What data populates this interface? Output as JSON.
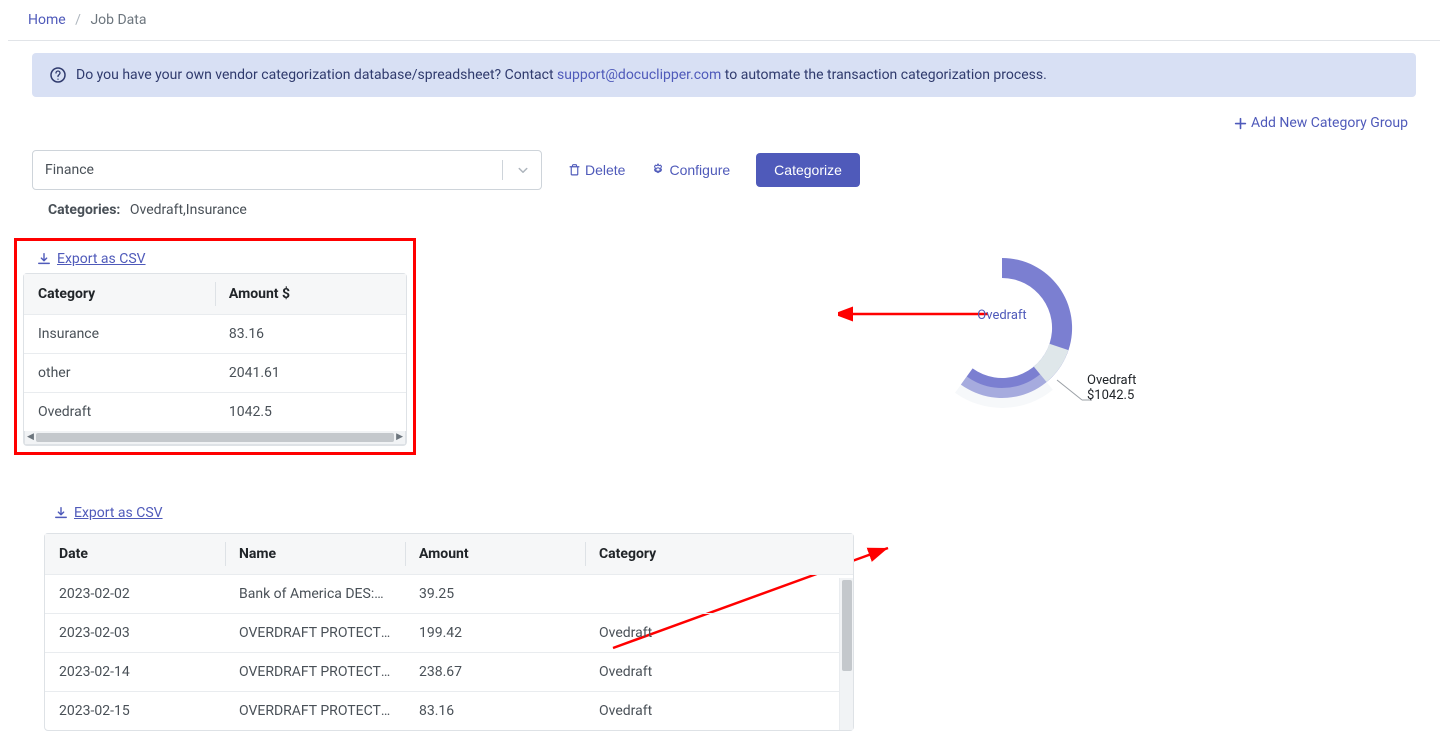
{
  "breadcrumb": {
    "home": "Home",
    "current": "Job Data"
  },
  "alert": {
    "pre": "Do you have your own vendor categorization database/spreadsheet? Contact ",
    "email": "support@docuclipper.com",
    "post": " to automate the transaction categorization process."
  },
  "toolbar": {
    "add_group": "Add New Category Group",
    "selected_group": "Finance",
    "delete": "Delete",
    "configure": "Configure",
    "categorize": "Categorize"
  },
  "categories": {
    "label": "Categories:",
    "list": "Ovedraft,Insurance"
  },
  "export_label": "Export as CSV",
  "summary_table": {
    "headers": {
      "category": "Category",
      "amount": "Amount $"
    },
    "rows": [
      {
        "category": "Insurance",
        "amount": "83.16"
      },
      {
        "category": "other",
        "amount": "2041.61"
      },
      {
        "category": "Ovedraft",
        "amount": "1042.5"
      }
    ]
  },
  "chart_data": {
    "type": "pie",
    "title": "",
    "series": [
      {
        "name": "Ovedraft",
        "value": 1042.5
      },
      {
        "name": "other",
        "value": 2041.61
      },
      {
        "name": "Insurance",
        "value": 83.16
      }
    ],
    "center_label": "Ovedraft",
    "callout": {
      "name": "Ovedraft",
      "value": "$1042.5"
    }
  },
  "tx_table": {
    "headers": {
      "date": "Date",
      "name": "Name",
      "amount": "Amount",
      "category": "Category"
    },
    "rows": [
      {
        "date": "2023-02-02",
        "name": "Bank of America DES:CA...",
        "amount": "39.25",
        "category": ""
      },
      {
        "date": "2023-02-03",
        "name": "OVERDRAFT PROTECTIO...",
        "amount": "199.42",
        "category": "Ovedraft"
      },
      {
        "date": "2023-02-14",
        "name": "OVERDRAFT PROTECTIO...",
        "amount": "238.67",
        "category": "Ovedraft"
      },
      {
        "date": "2023-02-15",
        "name": "OVERDRAFT PROTECTIO...",
        "amount": "83.16",
        "category": "Ovedraft"
      }
    ]
  }
}
